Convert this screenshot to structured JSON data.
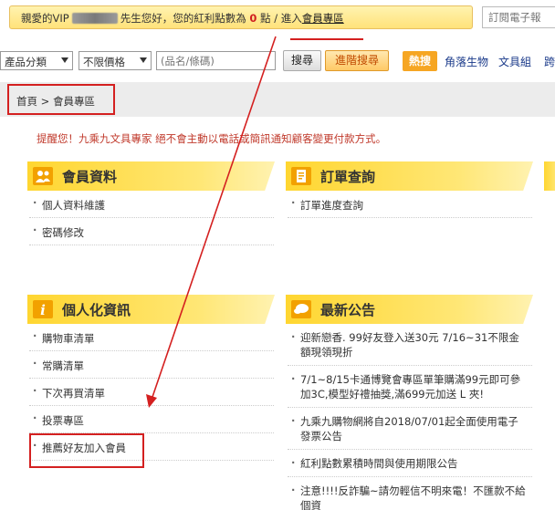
{
  "topbar": {
    "greeting": "親愛的VIP",
    "mid": "先生您好，您的紅利點數為",
    "points": "0",
    "unit": "點",
    "sep": "/ 進入",
    "member_link": "會員專區"
  },
  "subscribe": {
    "placeholder": "訂閱電子報"
  },
  "search": {
    "category": "產品分類",
    "price": "不限價格",
    "keyword_placeholder": "(品名/條碼)",
    "search_label": "搜尋",
    "advanced_label": "進階搜尋",
    "hot_label": "熱搜",
    "categories": [
      "角落生物",
      "文具組",
      "跨"
    ]
  },
  "breadcrumb": "首頁 > 會員專區",
  "notice": "提醒您！九乘九文具專家 絕不會主動以電話或簡訊通知顧客變更付款方式。",
  "member": {
    "title": "會員資料",
    "items": [
      "個人資料維護",
      "密碼修改"
    ]
  },
  "orders": {
    "title": "訂單查詢",
    "items": [
      "訂單進度查詢"
    ]
  },
  "personal": {
    "title": "個人化資訊",
    "items": [
      "購物車清單",
      "常購清單",
      "下次再買清單",
      "投票專區",
      "推薦好友加入會員"
    ]
  },
  "news": {
    "title": "最新公告",
    "items": [
      "迎新戀香. 99好友登入送30元 7/16~31不限金額現領現折",
      "7/1~8/15卡通博覽會專區單筆購滿99元即可參加3C,模型好禮抽獎,滿699元加送 L 夾!",
      "九乘九購物網將自2018/07/01起全面使用電子發票公告",
      "紅利點數累積時間與使用期限公告",
      "注意!!!!反詐騙~請勿輕信不明來電！不匯款不給個資"
    ]
  },
  "colors": {
    "panel": "#ffd630",
    "notice": "#c0392b",
    "annotation": "#d42020"
  }
}
